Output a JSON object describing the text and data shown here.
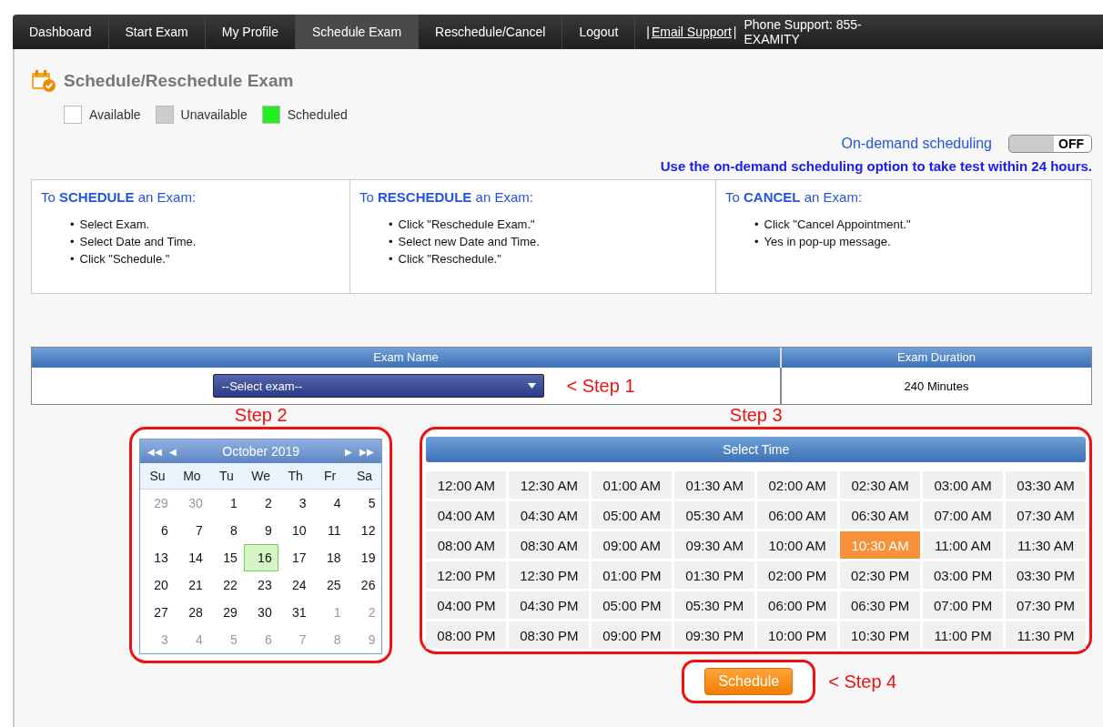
{
  "nav": {
    "items": [
      {
        "label": "Dashboard",
        "selected": false
      },
      {
        "label": "Start Exam",
        "selected": false
      },
      {
        "label": "My Profile",
        "selected": false
      },
      {
        "label": "Schedule Exam",
        "selected": true
      },
      {
        "label": "Reschedule/Cancel",
        "selected": false
      },
      {
        "label": "Logout",
        "selected": false
      }
    ],
    "support_prefix": "|",
    "email_link": "Email Support",
    "support_separator": "|",
    "phone": "Phone Support: 855-EXAMITY"
  },
  "page_title": "Schedule/Reschedule Exam",
  "legend": [
    {
      "label": "Available",
      "color": "#ffffff"
    },
    {
      "label": "Unavailable",
      "color": "#cccccc"
    },
    {
      "label": "Scheduled",
      "color": "#22ee22"
    }
  ],
  "on_demand": {
    "label": "On-demand scheduling",
    "on": false,
    "toggle_text": "OFF",
    "note": "Use the on-demand scheduling option to take test within 24 hours."
  },
  "instructions": [
    {
      "heading": "To **SCHEDULE** an Exam:",
      "bullet": "•",
      "steps": [
        "Select Exam.",
        "Select Date and Time.",
        "Click \"Schedule.\""
      ]
    },
    {
      "heading": "To **RESCHEDULE** an Exam:",
      "bullet": "•",
      "steps": [
        "Click \"Reschedule Exam.\"",
        "Select new Date and Time.",
        "Click \"Reschedule.\""
      ]
    },
    {
      "heading": "To **CANCEL** an Exam:",
      "bullet": "•",
      "steps": [
        "Click \"Cancel Appointment.\"",
        "Yes in pop-up message."
      ]
    }
  ],
  "exam_table": {
    "columns": [
      "Exam Name",
      "Exam Duration"
    ],
    "select_placeholder": "--Select exam--",
    "duration": "240 Minutes"
  },
  "steps": [
    "< Step 1",
    "Step 2",
    "Step 3",
    "< Step 4"
  ],
  "calendar": {
    "prev_year": "◀◀",
    "prev_month": "◀",
    "month": "October 2019",
    "next_month": "▶",
    "next_year": "▶▶",
    "weekdays": [
      "Su",
      "Mo",
      "Tu",
      "We",
      "Th",
      "Fr",
      "Sa"
    ],
    "days": [
      {
        "label": "29",
        "muted": true,
        "selected": false
      },
      {
        "label": "30",
        "muted": true,
        "selected": false
      },
      {
        "label": "1",
        "muted": false,
        "selected": false
      },
      {
        "label": "2",
        "muted": false,
        "selected": false
      },
      {
        "label": "3",
        "muted": false,
        "selected": false
      },
      {
        "label": "4",
        "muted": false,
        "selected": false
      },
      {
        "label": "5",
        "muted": false,
        "selected": false
      },
      {
        "label": "6",
        "muted": false,
        "selected": false
      },
      {
        "label": "7",
        "muted": false,
        "selected": false
      },
      {
        "label": "8",
        "muted": false,
        "selected": false
      },
      {
        "label": "9",
        "muted": false,
        "selected": false
      },
      {
        "label": "10",
        "muted": false,
        "selected": false
      },
      {
        "label": "11",
        "muted": false,
        "selected": false
      },
      {
        "label": "12",
        "muted": false,
        "selected": false
      },
      {
        "label": "13",
        "muted": false,
        "selected": false
      },
      {
        "label": "14",
        "muted": false,
        "selected": false
      },
      {
        "label": "15",
        "muted": false,
        "selected": false
      },
      {
        "label": "16",
        "muted": false,
        "selected": true
      },
      {
        "label": "17",
        "muted": false,
        "selected": false
      },
      {
        "label": "18",
        "muted": false,
        "selected": false
      },
      {
        "label": "19",
        "muted": false,
        "selected": false
      },
      {
        "label": "20",
        "muted": false,
        "selected": false
      },
      {
        "label": "21",
        "muted": false,
        "selected": false
      },
      {
        "label": "22",
        "muted": false,
        "selected": false
      },
      {
        "label": "23",
        "muted": false,
        "selected": false
      },
      {
        "label": "24",
        "muted": false,
        "selected": false
      },
      {
        "label": "25",
        "muted": false,
        "selected": false
      },
      {
        "label": "26",
        "muted": false,
        "selected": false
      },
      {
        "label": "27",
        "muted": false,
        "selected": false
      },
      {
        "label": "28",
        "muted": false,
        "selected": false
      },
      {
        "label": "29",
        "muted": false,
        "selected": false
      },
      {
        "label": "30",
        "muted": false,
        "selected": false
      },
      {
        "label": "31",
        "muted": false,
        "selected": false
      },
      {
        "label": "1",
        "muted": true,
        "selected": false
      },
      {
        "label": "2",
        "muted": true,
        "selected": false
      },
      {
        "label": "3",
        "muted": true,
        "selected": false
      },
      {
        "label": "4",
        "muted": true,
        "selected": false
      },
      {
        "label": "5",
        "muted": true,
        "selected": false
      },
      {
        "label": "6",
        "muted": true,
        "selected": false
      },
      {
        "label": "7",
        "muted": true,
        "selected": false
      },
      {
        "label": "8",
        "muted": true,
        "selected": false
      },
      {
        "label": "9",
        "muted": true,
        "selected": false
      }
    ]
  },
  "time_picker": {
    "title": "Select Time",
    "slots": [
      {
        "label": "12:00 AM",
        "selected": false
      },
      {
        "label": "12:30 AM",
        "selected": false
      },
      {
        "label": "01:00 AM",
        "selected": false
      },
      {
        "label": "01:30 AM",
        "selected": false
      },
      {
        "label": "02:00 AM",
        "selected": false
      },
      {
        "label": "02:30 AM",
        "selected": false
      },
      {
        "label": "03:00 AM",
        "selected": false
      },
      {
        "label": "03:30 AM",
        "selected": false
      },
      {
        "label": "04:00 AM",
        "selected": false
      },
      {
        "label": "04:30 AM",
        "selected": false
      },
      {
        "label": "05:00 AM",
        "selected": false
      },
      {
        "label": "05:30 AM",
        "selected": false
      },
      {
        "label": "06:00 AM",
        "selected": false
      },
      {
        "label": "06:30 AM",
        "selected": false
      },
      {
        "label": "07:00 AM",
        "selected": false
      },
      {
        "label": "07:30 AM",
        "selected": false
      },
      {
        "label": "08:00 AM",
        "selected": false
      },
      {
        "label": "08:30 AM",
        "selected": false
      },
      {
        "label": "09:00 AM",
        "selected": false
      },
      {
        "label": "09:30 AM",
        "selected": false
      },
      {
        "label": "10:00 AM",
        "selected": false
      },
      {
        "label": "10:30 AM",
        "selected": true
      },
      {
        "label": "11:00 AM",
        "selected": false
      },
      {
        "label": "11:30 AM",
        "selected": false
      },
      {
        "label": "12:00 PM",
        "selected": false
      },
      {
        "label": "12:30 PM",
        "selected": false
      },
      {
        "label": "01:00 PM",
        "selected": false
      },
      {
        "label": "01:30 PM",
        "selected": false
      },
      {
        "label": "02:00 PM",
        "selected": false
      },
      {
        "label": "02:30 PM",
        "selected": false
      },
      {
        "label": "03:00 PM",
        "selected": false
      },
      {
        "label": "03:30 PM",
        "selected": false
      },
      {
        "label": "04:00 PM",
        "selected": false
      },
      {
        "label": "04:30 PM",
        "selected": false
      },
      {
        "label": "05:00 PM",
        "selected": false
      },
      {
        "label": "05:30 PM",
        "selected": false
      },
      {
        "label": "06:00 PM",
        "selected": false
      },
      {
        "label": "06:30 PM",
        "selected": false
      },
      {
        "label": "07:00 PM",
        "selected": false
      },
      {
        "label": "07:30 PM",
        "selected": false
      },
      {
        "label": "08:00 PM",
        "selected": false
      },
      {
        "label": "08:30 PM",
        "selected": false
      },
      {
        "label": "09:00 PM",
        "selected": false
      },
      {
        "label": "09:30 PM",
        "selected": false
      },
      {
        "label": "10:00 PM",
        "selected": false
      },
      {
        "label": "10:30 PM",
        "selected": false
      },
      {
        "label": "11:00 PM",
        "selected": false
      },
      {
        "label": "11:30 PM",
        "selected": false
      }
    ]
  },
  "schedule_button": "Schedule"
}
